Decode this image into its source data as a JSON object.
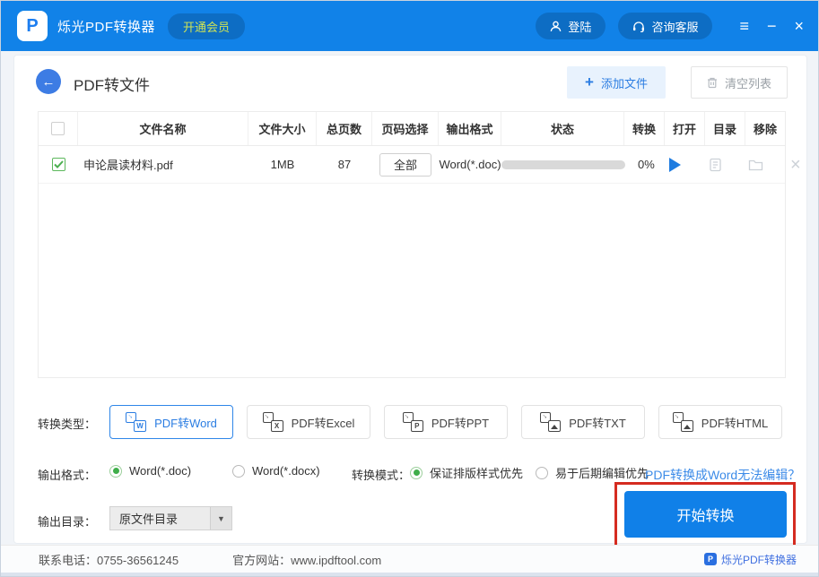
{
  "colors": {
    "topbar": "#1182e8",
    "accent_blue": "#1080e8",
    "badge_text": "#cfe354",
    "link": "#3c8be8",
    "radio_green": "#3fae4a",
    "highlight_red": "#d52b20",
    "progress_track": "#d9d9d9"
  },
  "titlebar": {
    "app_title": "烁光PDF转换器",
    "vip_badge": "开通会员",
    "login_label": "登陆",
    "support_label": "咨询客服"
  },
  "header": {
    "page_title": "PDF转文件",
    "add_files_label": "添加文件",
    "clear_list_label": "清空列表"
  },
  "table": {
    "headers": [
      "文件名称",
      "文件大小",
      "总页数",
      "页码选择",
      "输出格式",
      "状态",
      "转换",
      "打开",
      "目录",
      "移除"
    ],
    "row": {
      "checked": true,
      "file_name": "申论晨读材料.pdf",
      "file_size": "1MB",
      "pages": "87",
      "page_select_label": "全部",
      "output_format": "Word(*.doc)",
      "progress_percent": 0,
      "progress_text": "0%"
    }
  },
  "convert": {
    "label": "转换类型：",
    "tabs": [
      {
        "label": "PDF转Word",
        "letter": "W",
        "selected": true
      },
      {
        "label": "PDF转Excel",
        "letter": "X",
        "selected": false
      },
      {
        "label": "PDF转PPT",
        "letter": "P",
        "selected": false
      },
      {
        "label": "PDF转TXT",
        "letter": "",
        "selected": false
      },
      {
        "label": "PDF转HTML",
        "letter": "",
        "selected": false
      }
    ]
  },
  "format": {
    "label": "输出格式：",
    "options": [
      {
        "label": "Word(*.doc)",
        "selected": true
      },
      {
        "label": "Word(*.docx)",
        "selected": false
      }
    ]
  },
  "mode": {
    "label": "转换模式：",
    "options": [
      {
        "label": "保证排版样式优先",
        "selected": true
      },
      {
        "label": "易于后期编辑优先",
        "selected": false
      }
    ],
    "help_link": "PDF转换成Word无法编辑？"
  },
  "output_dir": {
    "label": "输出目录：",
    "value": "原文件目录"
  },
  "actions": {
    "start_label": "开始转换"
  },
  "footer": {
    "phone": "联系电话：0755-36561245",
    "website": "官方网站：www.ipdftool.com",
    "brand": "烁光PDF转换器"
  }
}
